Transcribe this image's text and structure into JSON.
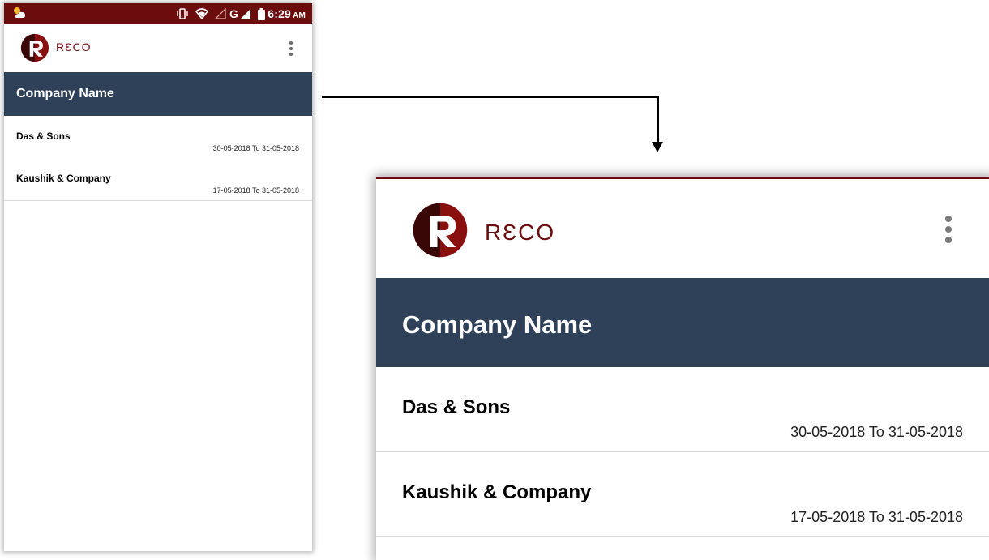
{
  "status_bar": {
    "time": "6:29",
    "ampm": "AM",
    "network": "G",
    "icons": [
      "weather-icon",
      "vibrate-icon",
      "wifi-icon",
      "signal-empty-icon",
      "signal-icon",
      "battery-icon"
    ]
  },
  "app": {
    "logo_text": "RƐCO",
    "menu_icon": "more-vert-icon"
  },
  "list_header": "Company Name",
  "companies": [
    {
      "name": "Das & Sons",
      "period": "30-05-2018 To 31-05-2018"
    },
    {
      "name": "Kaushik & Company",
      "period": "17-05-2018 To 31-05-2018"
    }
  ],
  "colors": {
    "status_bar": "#6b0d0d",
    "brand": "#6b0d0d",
    "header": "#2f4059",
    "divider": "#d9d9d9"
  }
}
